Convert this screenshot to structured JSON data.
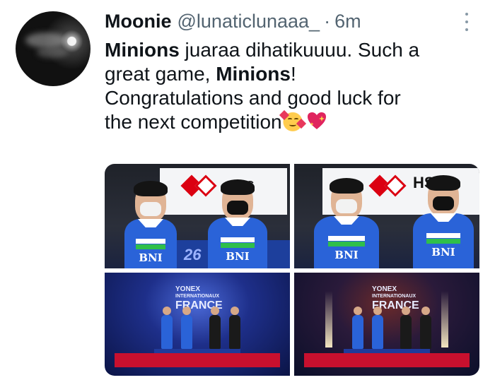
{
  "tweet": {
    "author": {
      "display_name": "Moonie",
      "handle": "@lunaticlunaaa_",
      "separator": "·",
      "time": "6m"
    },
    "text": {
      "line1_bold": "Minions",
      "line1_rest": " juaraa dihatikuuuu. Such a",
      "line2_start": "great game, ",
      "line2_bold": "Minions",
      "line2_end": "!",
      "line3": "Congratulations and good luck for",
      "line4": "the next competition"
    },
    "emojis": [
      "smiling-face-with-hearts-icon",
      "sparkling-heart-icon"
    ],
    "media": {
      "photo1": {
        "sponsor": "BNI",
        "banner_text": "26",
        "banner_text2": "BC"
      },
      "photo2": {
        "sponsor": "BNI",
        "banner_text": "HS"
      },
      "photo3": {
        "event_line1": "YONEX",
        "event_line2": "INTERNATIONAUX",
        "event_line3": "FRANCE"
      },
      "photo4": {
        "event_line1": "YONEX",
        "event_line2": "INTERNATIONAUX",
        "event_line3": "FRANCE"
      }
    }
  },
  "colors": {
    "text": "#0f1419",
    "muted": "#536471",
    "jersey": "#2a63d8",
    "stage_red": "#c8102e"
  }
}
